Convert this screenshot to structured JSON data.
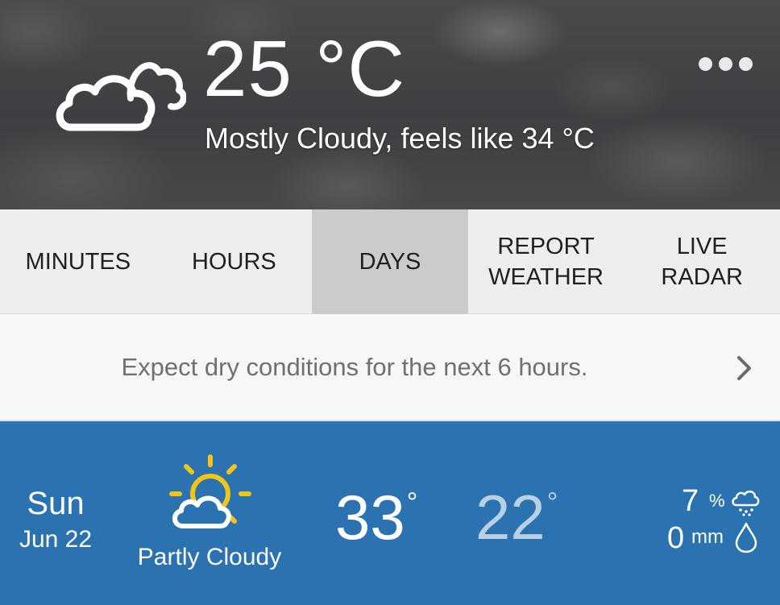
{
  "current": {
    "temperature": "25 °C",
    "summary": "Mostly Cloudy, feels like 34 °C",
    "icon": "cloud-icon"
  },
  "menu": {
    "icon": "more-dots-icon"
  },
  "tabs": [
    {
      "label": "MINUTES",
      "active": false
    },
    {
      "label": "HOURS",
      "active": false
    },
    {
      "label": "DAYS",
      "active": true
    },
    {
      "label": "REPORT WEATHER",
      "active": false
    },
    {
      "label": "LIVE RADAR",
      "active": false
    }
  ],
  "banner": {
    "text": "Expect dry conditions for the next 6 hours.",
    "icon": "chevron-right-icon"
  },
  "forecast": {
    "day": "Sun",
    "date": "Jun 22",
    "condition": "Partly Cloudy",
    "condition_icon": "partly-cloudy-icon",
    "high": "33",
    "low": "22",
    "degree_symbol": "°",
    "precip_chance": "7",
    "precip_chance_unit": "%",
    "precip_amount": "0",
    "precip_amount_unit": "mm"
  },
  "colors": {
    "forecast_bg": "#2a73b0",
    "active_tab": "#cbcbcb",
    "tab_bg": "#eeeeee",
    "sun_yellow": "#f2c518",
    "low_temp": "#b9cfe2"
  }
}
